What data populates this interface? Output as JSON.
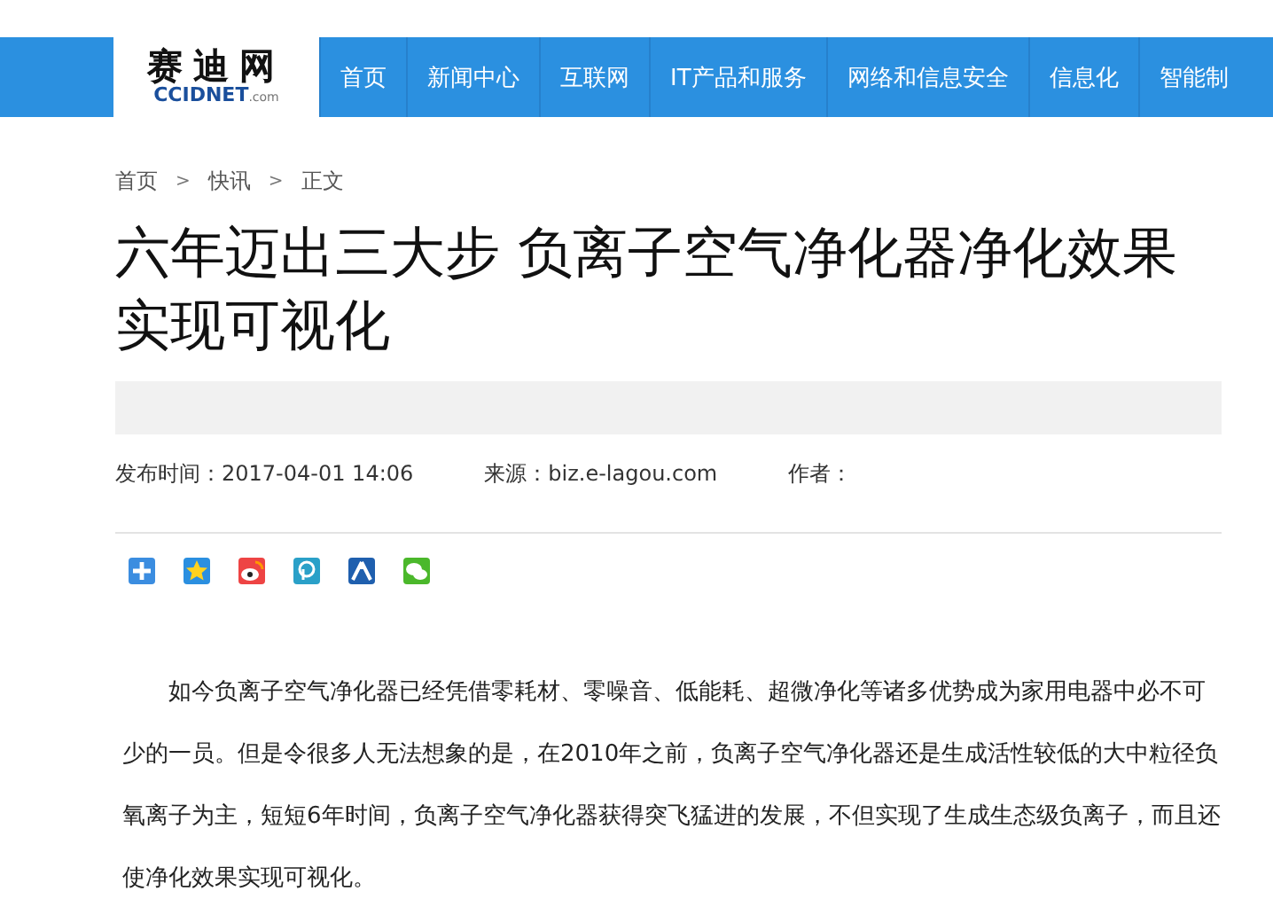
{
  "site": {
    "logo_name": "赛迪网",
    "logo_sub": "CCIDNET",
    "logo_domain": ".com"
  },
  "nav": [
    "首页",
    "新闻中心",
    "互联网",
    "IT产品和服务",
    "网络和信息安全",
    "信息化",
    "智能制"
  ],
  "breadcrumb": [
    "首页",
    "快讯",
    "正文"
  ],
  "breadcrumb_separator": ">",
  "title": "六年迈出三大步 负离子空气净化器净化效果实现可视化",
  "meta": {
    "published": "发布时间：2017-04-01 14:06",
    "source": "来源：biz.e-lagou.com",
    "author": "作者："
  },
  "share_icons": [
    {
      "kind": "plus"
    },
    {
      "kind": "qzone"
    },
    {
      "kind": "weibo"
    },
    {
      "kind": "pengyou"
    },
    {
      "kind": "renren"
    },
    {
      "kind": "wechat"
    }
  ],
  "body": "如今负离子空气净化器已经凭借零耗材、零噪音、低能耗、超微净化等诸多优势成为家用电器中必不可少的一员。但是令很多人无法想象的是，在2010年之前，负离子空气净化器还是生成活性较低的大中粒径负氧离子为主，短短6年时间，负离子空气净化器获得突飞猛进的发展，不但实现了生成生态级负离子，而且还使净化效果实现可视化。"
}
